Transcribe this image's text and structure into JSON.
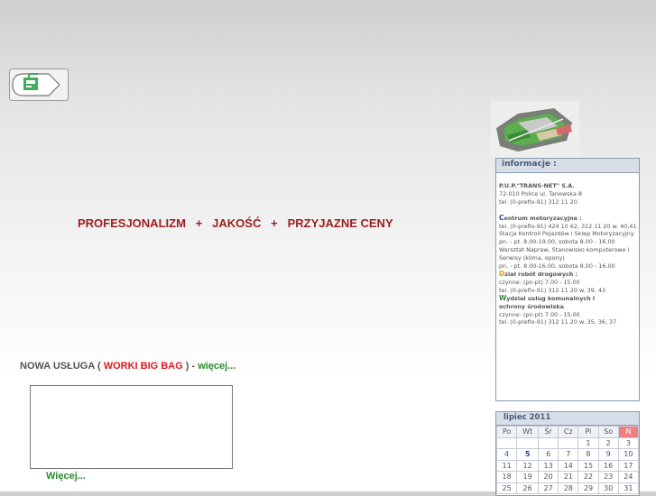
{
  "slogan": "PROFESJONALIZM   +   JAKOŚĆ   +   PRZYJAZNE CENY",
  "news": {
    "prefix": "NOWA USŁUGA ( ",
    "service": "WORKI BIG BAG",
    "suffix": " ) - ",
    "more": "więcej..."
  },
  "promo_more": "Więcej...",
  "info": {
    "title": "informacje :",
    "lines": [
      {
        "text": "P.U.P.\"TRANS-NET\" S.A.",
        "style": "b"
      },
      {
        "text": " 72-010 Police ul. Tanowska 8",
        "style": ""
      },
      {
        "text": " tel. (0-prefix-91) 312 11 20",
        "style": ""
      },
      {
        "text": "",
        "style": ""
      },
      {
        "cap": "C",
        "capColor": "blue",
        "text": "entrum motoryzacyjne :",
        "style": "b"
      },
      {
        "text": "  tel. (0-prefix-91) 424 10 62, 312 11 20 w. 40,41",
        "style": ""
      },
      {
        "text": " Stacja Kontroli Pojazdów i Sklep Motoryzacyjny",
        "style": ""
      },
      {
        "text": "  pn. - pt. 8.00-19.00, sobota 8.00 - 16.00",
        "style": ""
      },
      {
        "text": " Warsztat Napraw, Stanowisko komputerowe i",
        "style": ""
      },
      {
        "text": " Serwisy (klima, opony)",
        "style": ""
      },
      {
        "text": "  pn. - pt. 8.00-16.00, sobota 8.00 - 16.00",
        "style": ""
      },
      {
        "cap": "D",
        "capColor": "orange",
        "text": "ział robót drogowych :",
        "style": "b"
      },
      {
        "text": "  czynne: (pn-pt) 7.00 - 15.00",
        "style": ""
      },
      {
        "text": "  tel. (0-prefix-91) 312 11 20 w. 39, 43",
        "style": ""
      },
      {
        "cap": "W",
        "capColor": "green",
        "text": "ydział usług komunalnych i",
        "style": "b"
      },
      {
        "text": " ochrony środowiska",
        "style": "b"
      },
      {
        "text": "  czynne: (pn-pt) 7.00 - 15.00",
        "style": ""
      },
      {
        "text": "  tel. (0-prefix-91) 312 11 20 w. 35, 36, 37",
        "style": ""
      }
    ]
  },
  "calendar": {
    "title": "lipiec 2011",
    "days": [
      "Po",
      "Wt",
      "Śr",
      "Cz",
      "Pi",
      "So",
      "N"
    ],
    "weeks": [
      [
        "",
        "",
        "",
        "",
        "1",
        "2",
        "3"
      ],
      [
        "4",
        "5",
        "6",
        "7",
        "8",
        "9",
        "10"
      ],
      [
        "11",
        "12",
        "13",
        "14",
        "15",
        "16",
        "17"
      ],
      [
        "18",
        "19",
        "20",
        "21",
        "22",
        "23",
        "24"
      ],
      [
        "25",
        "26",
        "27",
        "28",
        "29",
        "30",
        "31"
      ]
    ],
    "today": "5"
  }
}
